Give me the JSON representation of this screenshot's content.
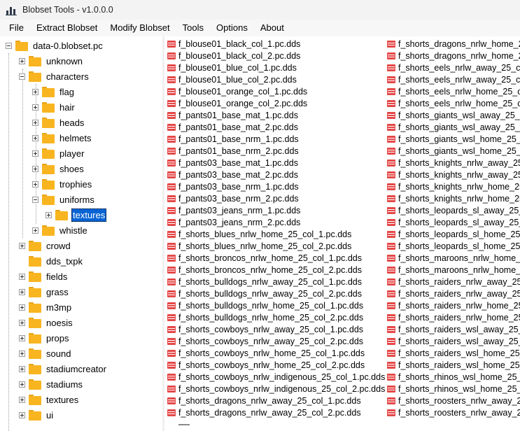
{
  "window": {
    "title": "Blobset Tools - v1.0.0.0"
  },
  "menu": [
    "File",
    "Extract Blobset",
    "Modify Blobset",
    "Tools",
    "Options",
    "About"
  ],
  "tree": [
    {
      "label": "data-0.blobset.pc",
      "depth": 0,
      "exp": "minus"
    },
    {
      "label": "unknown",
      "depth": 1,
      "exp": "plus"
    },
    {
      "label": "characters",
      "depth": 1,
      "exp": "minus"
    },
    {
      "label": "flag",
      "depth": 2,
      "exp": "plus"
    },
    {
      "label": "hair",
      "depth": 2,
      "exp": "plus"
    },
    {
      "label": "heads",
      "depth": 2,
      "exp": "plus"
    },
    {
      "label": "helmets",
      "depth": 2,
      "exp": "plus"
    },
    {
      "label": "player",
      "depth": 2,
      "exp": "plus"
    },
    {
      "label": "shoes",
      "depth": 2,
      "exp": "plus"
    },
    {
      "label": "trophies",
      "depth": 2,
      "exp": "plus"
    },
    {
      "label": "uniforms",
      "depth": 2,
      "exp": "minus"
    },
    {
      "label": "textures",
      "depth": 3,
      "exp": "plus",
      "selected": true
    },
    {
      "label": "whistle",
      "depth": 2,
      "exp": "plus"
    },
    {
      "label": "crowd",
      "depth": 1,
      "exp": "plus"
    },
    {
      "label": "dds_txpk",
      "depth": 1,
      "exp": "none"
    },
    {
      "label": "fields",
      "depth": 1,
      "exp": "plus"
    },
    {
      "label": "grass",
      "depth": 1,
      "exp": "plus"
    },
    {
      "label": "m3mp",
      "depth": 1,
      "exp": "plus"
    },
    {
      "label": "noesis",
      "depth": 1,
      "exp": "plus"
    },
    {
      "label": "props",
      "depth": 1,
      "exp": "plus"
    },
    {
      "label": "sound",
      "depth": 1,
      "exp": "plus"
    },
    {
      "label": "stadiumcreator",
      "depth": 1,
      "exp": "plus"
    },
    {
      "label": "stadiums",
      "depth": 1,
      "exp": "plus"
    },
    {
      "label": "textures",
      "depth": 1,
      "exp": "plus"
    },
    {
      "label": "ui",
      "depth": 1,
      "exp": "plus"
    }
  ],
  "files_col1": [
    "f_blouse01_black_col_1.pc.dds",
    "f_blouse01_black_col_2.pc.dds",
    "f_blouse01_blue_col_1.pc.dds",
    "f_blouse01_blue_col_2.pc.dds",
    "f_blouse01_orange_col_1.pc.dds",
    "f_blouse01_orange_col_2.pc.dds",
    "f_pants01_base_mat_1.pc.dds",
    "f_pants01_base_mat_2.pc.dds",
    "f_pants01_base_nrm_1.pc.dds",
    "f_pants01_base_nrm_2.pc.dds",
    "f_pants03_base_mat_1.pc.dds",
    "f_pants03_base_mat_2.pc.dds",
    "f_pants03_base_nrm_1.pc.dds",
    "f_pants03_base_nrm_2.pc.dds",
    "f_pants03_jeans_nrm_1.pc.dds",
    "f_pants03_jeans_nrm_2.pc.dds",
    "f_shorts_blues_nrlw_home_25_col_1.pc.dds",
    "f_shorts_blues_nrlw_home_25_col_2.pc.dds",
    "f_shorts_broncos_nrlw_home_25_col_1.pc.dds",
    "f_shorts_broncos_nrlw_home_25_col_2.pc.dds",
    "f_shorts_bulldogs_nrlw_away_25_col_1.pc.dds",
    "f_shorts_bulldogs_nrlw_away_25_col_2.pc.dds",
    "f_shorts_bulldogs_nrlw_home_25_col_1.pc.dds",
    "f_shorts_bulldogs_nrlw_home_25_col_2.pc.dds",
    "f_shorts_cowboys_nrlw_away_25_col_1.pc.dds",
    "f_shorts_cowboys_nrlw_away_25_col_2.pc.dds",
    "f_shorts_cowboys_nrlw_home_25_col_1.pc.dds",
    "f_shorts_cowboys_nrlw_home_25_col_2.pc.dds",
    "f_shorts_cowboys_nrlw_indigenous_25_col_1.pc.dds",
    "f_shorts_cowboys_nrlw_indigenous_25_col_2.pc.dds",
    "f_shorts_dragons_nrlw_away_25_col_1.pc.dds",
    "f_shorts_dragons_nrlw_away_25_col_2.pc.dds"
  ],
  "files_col2": [
    "f_shorts_dragons_nrlw_home_25_",
    "f_shorts_dragons_nrlw_home_25_",
    "f_shorts_eels_nrlw_away_25_col_1",
    "f_shorts_eels_nrlw_away_25_col_2",
    "f_shorts_eels_nrlw_home_25_col_1",
    "f_shorts_eels_nrlw_home_25_col_2",
    "f_shorts_giants_wsl_away_25_col_",
    "f_shorts_giants_wsl_away_25_col_",
    "f_shorts_giants_wsl_home_25_col_",
    "f_shorts_giants_wsl_home_25_col_",
    "f_shorts_knights_nrlw_away_25_c",
    "f_shorts_knights_nrlw_away_25_c",
    "f_shorts_knights_nrlw_home_25_c",
    "f_shorts_knights_nrlw_home_25_c",
    "f_shorts_leopards_sl_away_25_co",
    "f_shorts_leopards_sl_away_25_co",
    "f_shorts_leopards_sl_home_25_co",
    "f_shorts_leopards_sl_home_25_co",
    "f_shorts_maroons_nrlw_home_25",
    "f_shorts_maroons_nrlw_home_25",
    "f_shorts_raiders_nrlw_away_25_co",
    "f_shorts_raiders_nrlw_away_25_co",
    "f_shorts_raiders_nrlw_home_25_co",
    "f_shorts_raiders_nrlw_home_25_co",
    "f_shorts_raiders_wsl_away_25_col",
    "f_shorts_raiders_wsl_away_25_col",
    "f_shorts_raiders_wsl_home_25_col",
    "f_shorts_raiders_wsl_home_25_col",
    "f_shorts_rhinos_wsl_home_25_col",
    "f_shorts_rhinos_wsl_home_25_col",
    "f_shorts_roosters_nrlw_away_25_c",
    "f_shorts_roosters_nrlw_away_25_c"
  ]
}
